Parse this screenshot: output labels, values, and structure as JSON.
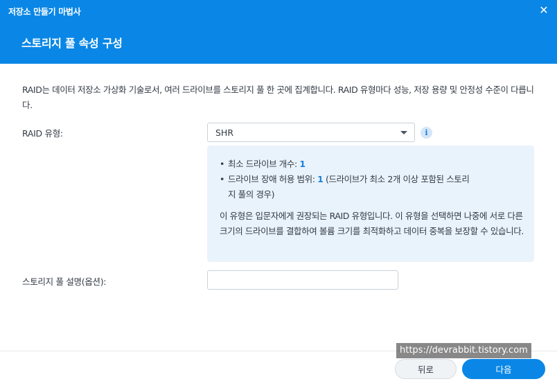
{
  "window": {
    "title": "저장소 만들기 마법사",
    "close_glyph": "✕"
  },
  "step": {
    "title": "스토리지 풀 속성 구성"
  },
  "description": "RAID는 데이터 저장소 가상화 기술로서, 여러 드라이브를 스토리지 풀 한 곳에 집계합니다. RAID 유형마다 성능, 저장 용량 및 안정성 수준이 다릅니다.",
  "raid_type": {
    "label": "RAID 유형:",
    "value": "SHR",
    "info_glyph": "i"
  },
  "info": {
    "bullet1_label": "최소 드라이브 개수: ",
    "bullet1_value": "1",
    "bullet2_label": "드라이브 장애 허용 범위: ",
    "bullet2_value": "1",
    "bullet2_note_line1": " (드라이브가 최소 2개 이상 포함된 스토리",
    "bullet2_note_line2": "지 풀의 경우)",
    "paragraph": "이 유형은 입문자에게 권장되는 RAID 유형입니다. 이 유형을 선택하면 나중에 서로 다른 크기의 드라이브를 결합하여 볼륨 크기를 최적화하고 데이터 중복을 보장할 수 있습니다."
  },
  "pool_description": {
    "label": "스토리지 풀 설명(옵션):",
    "value": "",
    "placeholder": ""
  },
  "footer": {
    "back_label": "뒤로",
    "next_label": "다음"
  },
  "watermark": "https://devrabbit.tistory.com",
  "colors": {
    "header_bg": "#0a87e6",
    "accent": "#1b7fd6",
    "info_box_bg": "#e9f3fc"
  }
}
